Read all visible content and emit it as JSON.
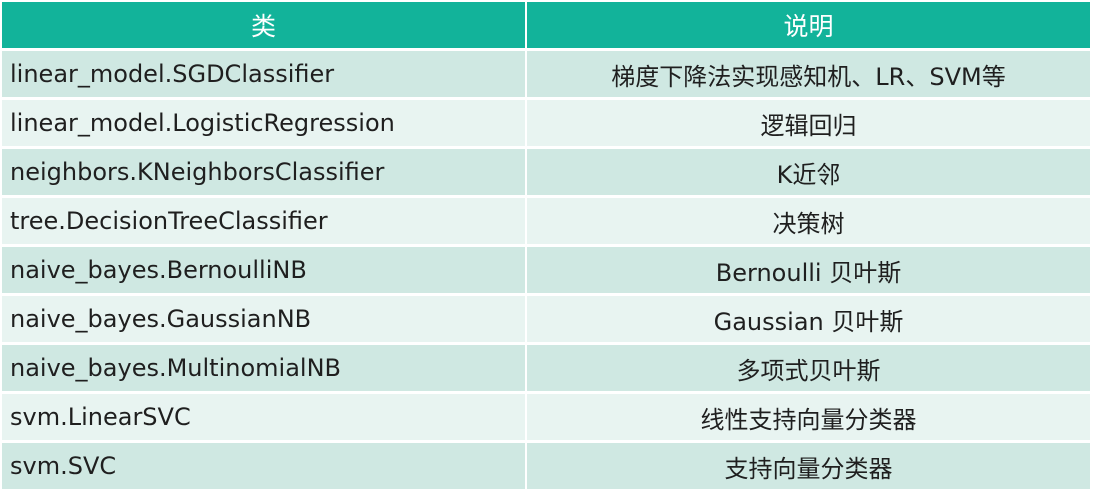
{
  "table": {
    "headers": [
      "类",
      "说明"
    ],
    "rows": [
      [
        "linear_model.SGDClassifier",
        "梯度下降法实现感知机、LR、SVM等"
      ],
      [
        "linear_model.LogisticRegression",
        "逻辑回归"
      ],
      [
        "neighbors.KNeighborsClassifier",
        "K近邻"
      ],
      [
        "tree.DecisionTreeClassifier",
        "决策树"
      ],
      [
        "naive_bayes.BernoulliNB",
        "Bernoulli 贝叶斯"
      ],
      [
        "naive_bayes.GaussianNB",
        "Gaussian 贝叶斯"
      ],
      [
        "naive_bayes.MultinomialNB",
        "多项式贝叶斯"
      ],
      [
        "svm.LinearSVC",
        "线性支持向量分类器"
      ],
      [
        "svm.SVC",
        "支持向量分类器"
      ]
    ]
  },
  "colors": {
    "header_bg": "#12b39a",
    "row_odd_bg": "#cfe8e2",
    "row_even_bg": "#e8f4f1"
  }
}
